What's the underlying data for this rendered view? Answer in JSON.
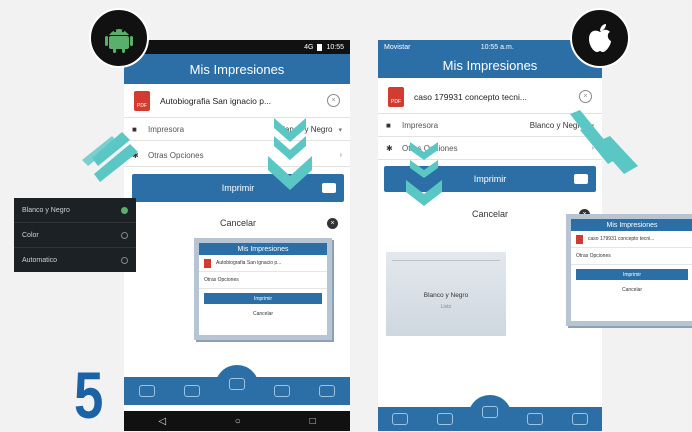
{
  "step_number": "5",
  "android": {
    "status_time": "10:55",
    "status_signal": "4G",
    "title": "Mis Impresiones",
    "document": {
      "name": "Autobiografia San ignacio p..."
    },
    "printer": {
      "label": "Impresora",
      "value": "Blanco y Negro"
    },
    "more_options": "Otras Opciones",
    "print_label": "Imprimir",
    "cancel_label": "Cancelar",
    "color_menu": [
      "Blanco y Negro",
      "Color",
      "Automatico"
    ],
    "mini": {
      "title": "Mis Impresiones",
      "document": "Autobiografia San ignacio p...",
      "more_options": "Otras Opciones",
      "print_label": "Imprimir",
      "cancel_label": "Cancelar"
    }
  },
  "ios": {
    "carrier": "Movistar",
    "time": "10:55 a.m.",
    "title": "Mis Impresiones",
    "document": {
      "name": "caso 179931 concepto tecni..."
    },
    "printer": {
      "label": "Impresora",
      "value": "Blanco y Negro"
    },
    "more_options": "Otras Opciones",
    "print_label": "Imprimir",
    "cancel_label": "Cancelar",
    "sheet_option": "Blanco y Negro",
    "sheet_action": "Listo",
    "mini": {
      "title": "Mis Impresiones",
      "document": "caso 179931 concepto tecni...",
      "more_options": "Otras Opciones",
      "print_label": "Imprimir",
      "cancel_label": "Cancelar"
    }
  },
  "colors": {
    "brand_blue": "#2b6fa6",
    "android_green": "#5ab06b",
    "chevron_teal": "#5bc7c5"
  },
  "icons": [
    "android-logo-icon",
    "apple-logo-icon",
    "printer-icon",
    "gear-icon",
    "close-icon",
    "home-icon",
    "bell-icon",
    "location-icon",
    "back-icon",
    "recents-icon"
  ]
}
